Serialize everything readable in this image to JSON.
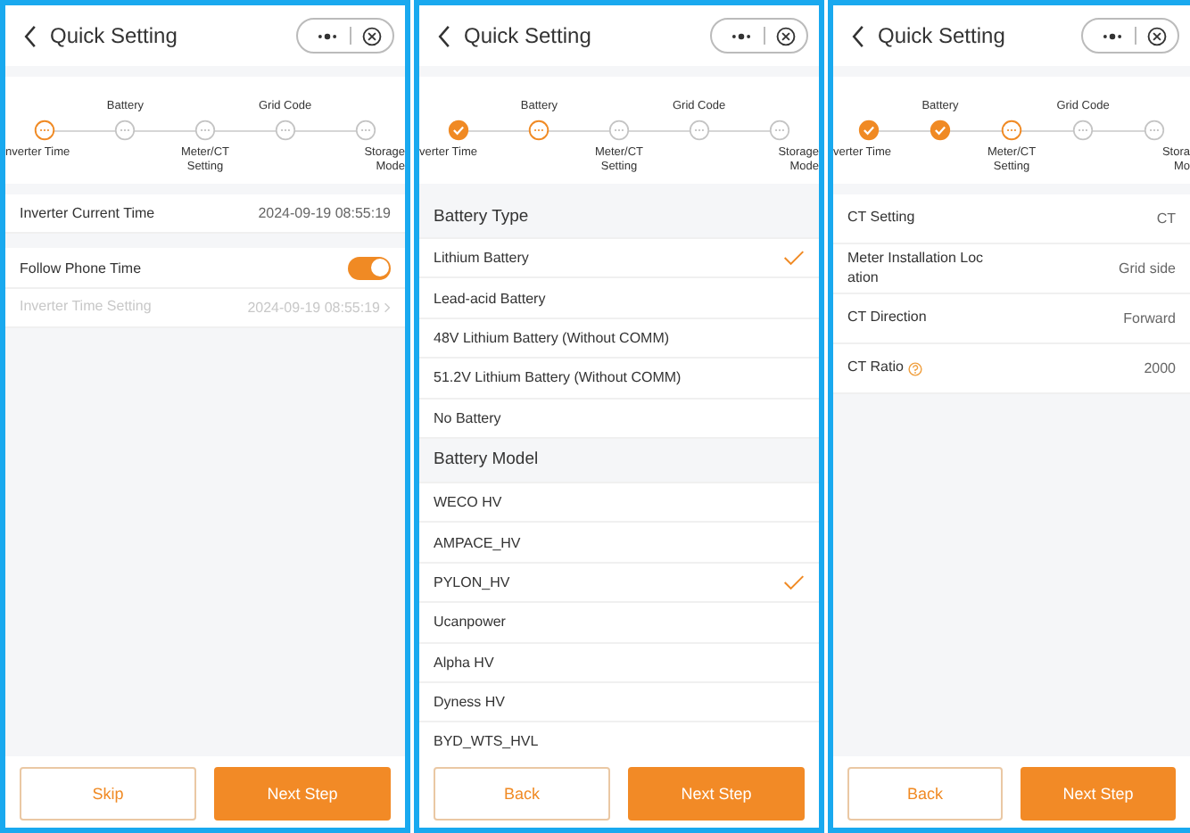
{
  "screens": [
    {
      "title": "Quick Setting",
      "steps": [
        {
          "label": "nverter Time",
          "done": false,
          "current": true
        },
        {
          "label": "Battery",
          "done": false,
          "current": false
        },
        {
          "label": "Meter/CT Setting",
          "done": false,
          "current": false
        },
        {
          "label": "Grid Code",
          "done": false,
          "current": false
        },
        {
          "label": "Storage Mode",
          "done": false,
          "current": false
        }
      ],
      "rows": [
        {
          "kind": "value",
          "label": "Inverter Current Time",
          "value": "2024-09-19 08:55:19",
          "disabled": false
        },
        {
          "kind": "gap"
        },
        {
          "kind": "toggle",
          "label": "Follow Phone Time",
          "on": true
        },
        {
          "kind": "link",
          "label": "Inverter Time Setting",
          "value": "2024-09-19 08:55:19",
          "disabled": true
        }
      ],
      "buttons": [
        {
          "label": "Skip",
          "kind": "secondary"
        },
        {
          "label": "Next Step",
          "kind": "primary"
        }
      ]
    },
    {
      "title": "Quick Setting",
      "steps": [
        {
          "label": "verter Time",
          "done": true,
          "current": false
        },
        {
          "label": "Battery",
          "done": false,
          "current": true
        },
        {
          "label": "Meter/CT Setting",
          "done": false,
          "current": false
        },
        {
          "label": "Grid Code",
          "done": false,
          "current": false
        },
        {
          "label": "Storage Mode",
          "done": false,
          "current": false
        }
      ],
      "rows": [
        {
          "kind": "header",
          "label": "Battery Type"
        },
        {
          "kind": "option",
          "label": "Lithium Battery",
          "selected": true
        },
        {
          "kind": "option",
          "label": "Lead-acid Battery",
          "selected": false
        },
        {
          "kind": "option",
          "label": "48V Lithium Battery (Without COMM)",
          "selected": false
        },
        {
          "kind": "option",
          "label": "51.2V Lithium Battery (Without COMM)",
          "selected": false
        },
        {
          "kind": "option",
          "label": "No Battery",
          "selected": false
        },
        {
          "kind": "header",
          "label": "Battery Model"
        },
        {
          "kind": "option",
          "label": "WECO HV",
          "selected": false
        },
        {
          "kind": "option",
          "label": "AMPACE_HV",
          "selected": false
        },
        {
          "kind": "option",
          "label": "PYLON_HV",
          "selected": true
        },
        {
          "kind": "option",
          "label": "Ucanpower",
          "selected": false
        },
        {
          "kind": "option",
          "label": "Alpha HV",
          "selected": false
        },
        {
          "kind": "option",
          "label": "Dyness HV",
          "selected": false
        },
        {
          "kind": "option",
          "label": "BYD_WTS_HVL",
          "selected": false
        }
      ],
      "buttons": [
        {
          "label": "Back",
          "kind": "secondary"
        },
        {
          "label": "Next Step",
          "kind": "primary"
        }
      ]
    },
    {
      "title": "Quick Setting",
      "steps": [
        {
          "label": "verter Time",
          "done": true,
          "current": false
        },
        {
          "label": "Battery",
          "done": true,
          "current": false
        },
        {
          "label": "Meter/CT Setting",
          "done": false,
          "current": true
        },
        {
          "label": "Grid Code",
          "done": false,
          "current": false
        },
        {
          "label": "Stora Mo",
          "done": false,
          "current": false
        }
      ],
      "rows": [
        {
          "kind": "value",
          "label": "CT Setting",
          "value": "CT",
          "disabled": false
        },
        {
          "kind": "value",
          "label": "Meter Installation Location",
          "value": "Grid side",
          "disabled": false
        },
        {
          "kind": "value",
          "label": "CT Direction",
          "value": "Forward",
          "disabled": false
        },
        {
          "kind": "help",
          "label": "CT Ratio",
          "value": "2000",
          "disabled": false
        }
      ],
      "buttons": [
        {
          "label": "Back",
          "kind": "secondary"
        },
        {
          "label": "Next Step",
          "kind": "primary"
        }
      ]
    }
  ]
}
